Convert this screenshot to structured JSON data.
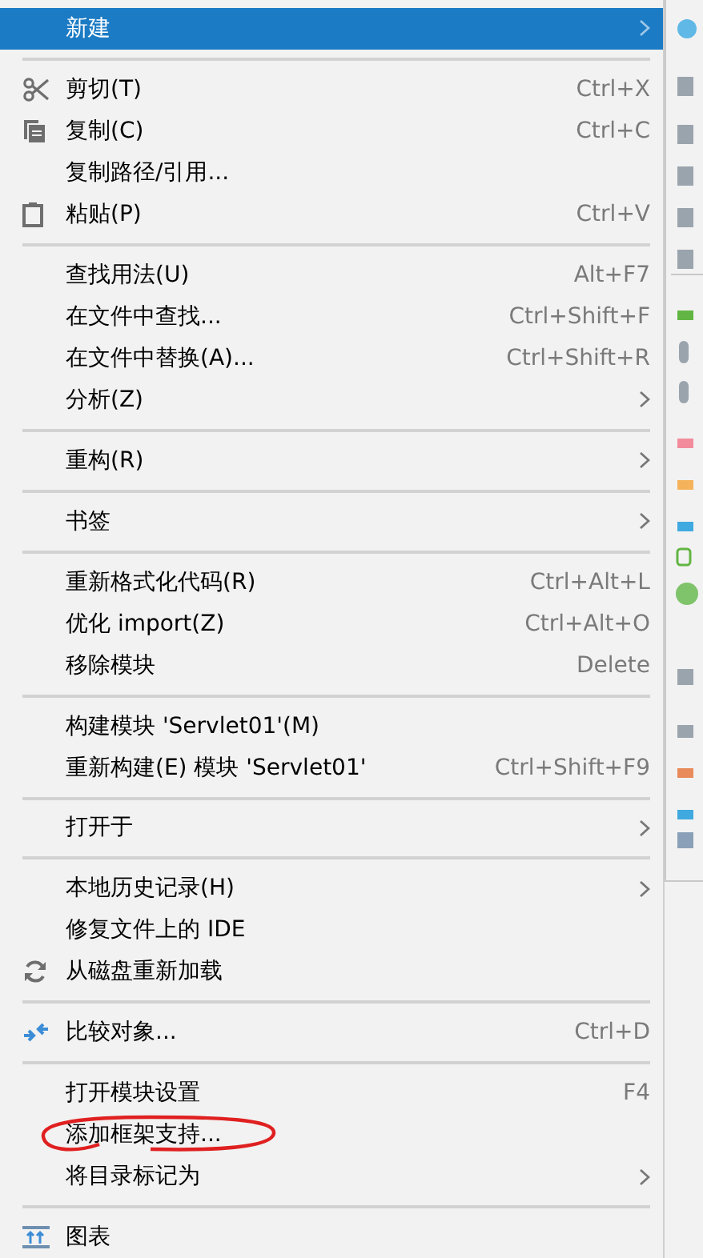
{
  "menu": {
    "items": [
      {
        "kind": "item",
        "label": "新建",
        "submenu": true,
        "selected": true
      },
      {
        "kind": "separator"
      },
      {
        "kind": "item",
        "label": "剪切(T)",
        "shortcut": "Ctrl+X",
        "selected": false
      },
      {
        "kind": "item",
        "label": "复制(C)",
        "shortcut": "Ctrl+C",
        "selected": false
      },
      {
        "kind": "item",
        "label": "复制路径/引用...",
        "selected": false
      },
      {
        "kind": "item",
        "label": "粘贴(P)",
        "shortcut": "Ctrl+V",
        "selected": false
      },
      {
        "kind": "separator"
      },
      {
        "kind": "item",
        "label": "查找用法(U)",
        "shortcut": "Alt+F7",
        "selected": false
      },
      {
        "kind": "item",
        "label": "在文件中查找...",
        "shortcut": "Ctrl+Shift+F",
        "selected": false
      },
      {
        "kind": "item",
        "label": "在文件中替换(A)...",
        "shortcut": "Ctrl+Shift+R",
        "selected": false
      },
      {
        "kind": "item",
        "label": "分析(Z)",
        "submenu": true,
        "selected": false
      },
      {
        "kind": "separator"
      },
      {
        "kind": "item",
        "label": "重构(R)",
        "submenu": true,
        "selected": false
      },
      {
        "kind": "separator"
      },
      {
        "kind": "item",
        "label": "书签",
        "submenu": true,
        "selected": false
      },
      {
        "kind": "separator"
      },
      {
        "kind": "item",
        "label": "重新格式化代码(R)",
        "shortcut": "Ctrl+Alt+L",
        "selected": false
      },
      {
        "kind": "item",
        "label": "优化 import(Z)",
        "shortcut": "Ctrl+Alt+O",
        "selected": false
      },
      {
        "kind": "item",
        "label": "移除模块",
        "shortcut": "Delete",
        "selected": false
      },
      {
        "kind": "separator"
      },
      {
        "kind": "item",
        "label": "构建模块 'Servlet01'(M)",
        "selected": false
      },
      {
        "kind": "item",
        "label": "重新构建(E) 模块 'Servlet01'",
        "shortcut": "Ctrl+Shift+F9",
        "selected": false
      },
      {
        "kind": "separator"
      },
      {
        "kind": "item",
        "label": "打开于",
        "submenu": true,
        "selected": false
      },
      {
        "kind": "separator"
      },
      {
        "kind": "item",
        "label": "本地历史记录(H)",
        "submenu": true,
        "selected": false
      },
      {
        "kind": "item",
        "label": "修复文件上的 IDE",
        "selected": false
      },
      {
        "kind": "item",
        "label": "从磁盘重新加载",
        "selected": false
      },
      {
        "kind": "separator"
      },
      {
        "kind": "item",
        "label": "比较对象...",
        "shortcut": "Ctrl+D",
        "selected": false
      },
      {
        "kind": "separator"
      },
      {
        "kind": "item",
        "label": "打开模块设置",
        "shortcut": "F4",
        "selected": false
      },
      {
        "kind": "item",
        "label": "添加框架支持...",
        "circled": true,
        "selected": false
      },
      {
        "kind": "item",
        "label": "将目录标记为",
        "submenu": true,
        "selected": false
      },
      {
        "kind": "separator"
      },
      {
        "kind": "item",
        "label": "图表",
        "selected": false
      }
    ]
  }
}
